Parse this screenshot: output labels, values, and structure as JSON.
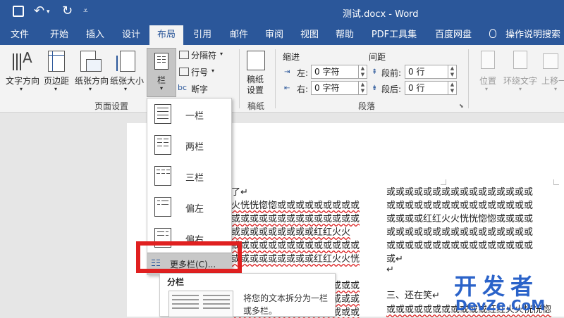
{
  "title": "测试.docx - Word",
  "tabs": [
    "文件",
    "开始",
    "插入",
    "设计",
    "布局",
    "引用",
    "邮件",
    "审阅",
    "视图",
    "帮助",
    "PDF工具集",
    "百度网盘",
    "操作说明搜索"
  ],
  "ribbon": {
    "text_direction": "文字方向",
    "margins": "页边距",
    "orientation": "纸张方向",
    "size": "纸张大小",
    "columns": "栏",
    "breaks": "分隔符",
    "line_numbers": "行号",
    "hyphenation": "断字",
    "page_setup_group": "页面设置",
    "draft_paper": "稿纸\n设置",
    "draft_group": "稿纸",
    "indent_label": "缩进",
    "spacing_label": "间距",
    "left_label": "左:",
    "right_label": "右:",
    "before_label": "段前:",
    "after_label": "段后:",
    "left_value": "0 字符",
    "right_value": "0 字符",
    "before_value": "0 行",
    "after_value": "0 行",
    "paragraph_group": "段落",
    "position": "位置",
    "wrap_text": "环绕文字",
    "bring_forward": "上移一"
  },
  "dropdown": {
    "items": [
      "一栏",
      "两栏",
      "三栏",
      "偏左",
      "偏右"
    ],
    "more": "更多栏(C)..."
  },
  "tooltip": {
    "title": "分栏",
    "body": "将您的文本拆分为一栏或多栏。"
  },
  "document": {
    "left_lines": [
      "了↵",
      "火恍恍惚惚或或或或或或或或或",
      "或或或或或或或或或或或或或或",
      "或或或或或或或或或红红火火",
      "或或或或或或或或或或或或或或",
      "或或或或或或或或或红红火火恍",
      "或或或或或或或或或或或或或或",
      "或或或或或或或或或或或或或或",
      "火火恍恍惚惚或或或或或或或或"
    ],
    "right_lines": [
      "或或或或或或或或或或或或或或或或",
      "或或或或或或或或或或或或或或或或",
      "或或或或红红火火恍恍惚惚或或或或",
      "或或或或或或或或或或或或或或或或",
      "或或或或或或或或或或或或或或或或",
      "或↵",
      "↵",
      "三、还在笑↵",
      "或或或或或或或或或或或红红火火恍恍惚"
    ]
  },
  "watermark": {
    "cn": "开发者",
    "en": "DevZe.CoM"
  }
}
